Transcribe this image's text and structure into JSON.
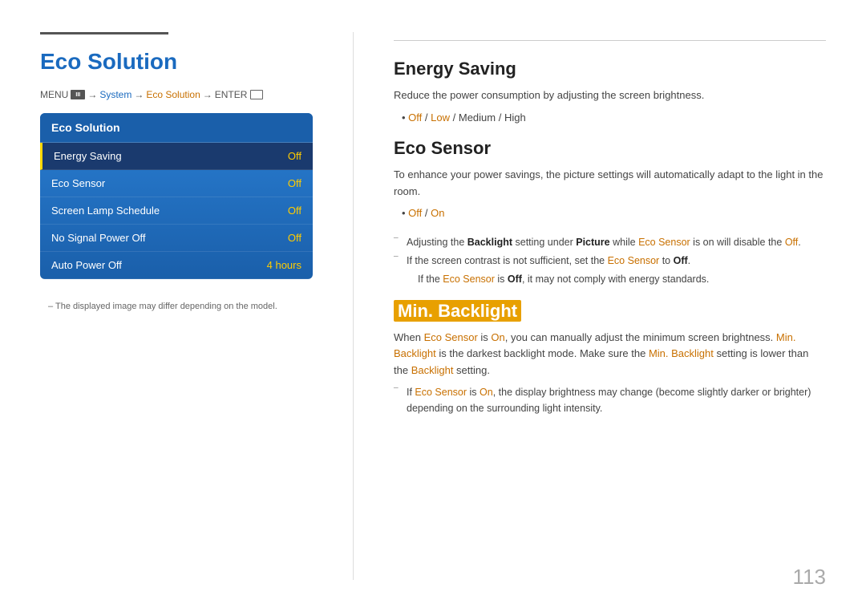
{
  "page": {
    "number": "113"
  },
  "left": {
    "title": "Eco Solution",
    "menu_path": {
      "menu": "MENU",
      "sep1": "→",
      "system": "System",
      "sep2": "→",
      "eco_solution": "Eco Solution",
      "sep3": "→",
      "enter": "ENTER"
    },
    "eco_box": {
      "title": "Eco Solution",
      "items": [
        {
          "label": "Energy Saving",
          "value": "Off",
          "active": true
        },
        {
          "label": "Eco Sensor",
          "value": "Off",
          "active": false
        },
        {
          "label": "Screen Lamp Schedule",
          "value": "Off",
          "active": false
        },
        {
          "label": "No Signal Power Off",
          "value": "Off",
          "active": false
        },
        {
          "label": "Auto Power Off",
          "value": "4 hours",
          "active": false
        }
      ]
    },
    "footnote": "The displayed image may differ depending on the model."
  },
  "right": {
    "energy_saving": {
      "title": "Energy Saving",
      "description": "Reduce the power consumption by adjusting the screen brightness.",
      "options": "Off / Low / Medium / High"
    },
    "eco_sensor": {
      "title": "Eco Sensor",
      "description": "To enhance your power savings, the picture settings will automatically adapt to the light in the room.",
      "options": "Off / On",
      "note1": "Adjusting the Backlight setting under Picture while Eco Sensor is on will disable the Off.",
      "note2": "If the screen contrast is not sufficient, set the Eco Sensor to Off.",
      "note3": "If the Eco Sensor is Off, it may not comply with energy standards."
    },
    "min_backlight": {
      "title": "Min. Backlight",
      "description1": "When Eco Sensor is On, you can manually adjust the minimum screen brightness. Min. Backlight is the darkest backlight mode. Make sure the Min. Backlight setting is lower than the Backlight setting.",
      "note1": "If Eco Sensor is On, the display brightness may change (become slightly darker or brighter) depending on the surrounding light intensity."
    }
  }
}
